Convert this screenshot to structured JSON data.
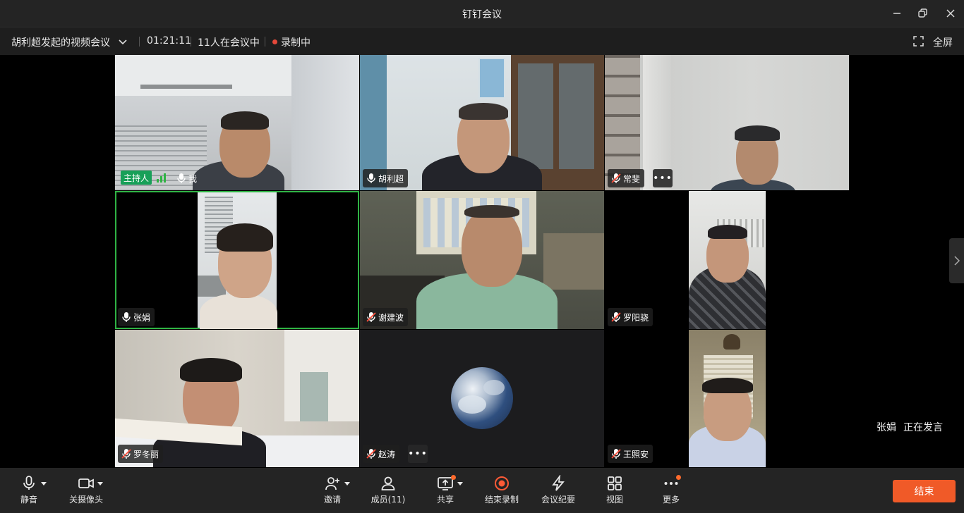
{
  "app": {
    "title": "钉钉会议"
  },
  "infobar": {
    "meeting_title": "胡利超发起的视频会议",
    "duration": "01:21:11",
    "participants_in_meeting": "11人在会议中",
    "recording_status": "录制中",
    "fullscreen_label": "全屏"
  },
  "participants": [
    {
      "name": "我",
      "host_badge": "主持人",
      "mic": "on"
    },
    {
      "name": "胡利超",
      "mic": "on"
    },
    {
      "name": "常斐",
      "mic": "muted",
      "more": "•••"
    },
    {
      "name": "张娟",
      "mic": "on",
      "active": true
    },
    {
      "name": "谢建波",
      "mic": "muted"
    },
    {
      "name": "罗阳骁",
      "mic": "muted"
    },
    {
      "name": "罗冬丽",
      "mic": "muted"
    },
    {
      "name": "赵涛",
      "mic": "muted",
      "more": "•••"
    },
    {
      "name": "王照安",
      "mic": "muted"
    }
  ],
  "speaking": {
    "name": "张娟",
    "status": "正在发言"
  },
  "toolbar": {
    "mute": "静音",
    "camera_off": "关摄像头",
    "invite": "邀请",
    "members": "成员(11)",
    "share": "共享",
    "end_recording": "结束录制",
    "minutes": "会议纪要",
    "view": "视图",
    "more": "更多",
    "end": "结束"
  },
  "colors": {
    "accent_green": "#2fb344",
    "host_badge": "#18a058",
    "end_button": "#f05a28",
    "notification": "#ff6a2c",
    "record": "#e5483a"
  }
}
